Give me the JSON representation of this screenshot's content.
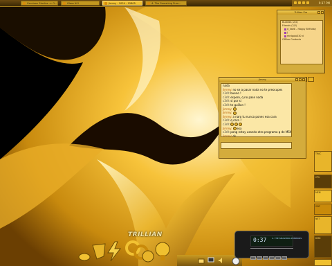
{
  "taskbar": {
    "tasks": [
      {
        "label": "Cerulean Studios -> O...",
        "active": false
      },
      {
        "label": "Glass N-2",
        "active": false
      },
      {
        "label": "Jimmy - 1024 - 15805",
        "active": true
      },
      {
        "label": "4. The Smashing Pum...",
        "active": false
      }
    ],
    "clock": "9:37 PM"
  },
  "contacts": {
    "title": "Trillian Pro",
    "rows": [
      {
        "text": "Buddies (2/2)",
        "sub": false,
        "icon": false
      },
      {
        "text": "Friends (2/2)",
        "sub": false,
        "icon": false
      },
      {
        "text": "d_kaeb - Happy Birthday",
        "sub": true,
        "icon": true
      },
      {
        "text": "j",
        "sub": true,
        "icon": true
      },
      {
        "text": "mrdpolo330 d",
        "sub": true,
        "icon": true
      },
      {
        "text": "Offline Contacts",
        "sub": false,
        "icon": false
      }
    ]
  },
  "chat": {
    "title": "Jimmy",
    "messages": [
      {
        "nick": "",
        "text": "nada",
        "emo": 0
      },
      {
        "nick": "Jimmy:",
        "text": "no se a pasar nada no te preocupes",
        "emo": 0
      },
      {
        "nick": "c3r0:",
        "text": "bueno !",
        "emo": 0
      },
      {
        "nick": "c3r0:",
        "text": "espero, q no pase nada",
        "emo": 0
      },
      {
        "nick": "c3r0:",
        "text": "si por si",
        "emo": 0
      },
      {
        "nick": "c3r0:",
        "text": "te guillan !",
        "emo": 0
      },
      {
        "nick": "Jimmy:",
        "text": "",
        "emo": 1
      },
      {
        "nick": "Jimmy:",
        "text": "",
        "emo": 1
      },
      {
        "nick": "Jimmy:",
        "text": "a naro tu nunca pones esa cara",
        "emo": 0
      },
      {
        "nick": "c3r0:",
        "text": "q cara ?",
        "emo": 0
      },
      {
        "nick": "c3r0:",
        "text": "",
        "emo": 3
      },
      {
        "nick": "Jimmy:",
        "text": "esa",
        "emo": 1
      },
      {
        "nick": "c3r0:",
        "text": "pong estoy usando otro programa q de MSN",
        "emo": 0
      },
      {
        "nick": "Jimmy:",
        "text": "ok",
        "emo": 0
      }
    ]
  },
  "dock": {
    "logo": "TRILLIAN"
  },
  "player": {
    "time": "0:37",
    "track": "4. THE SMASHING PUMPKINS"
  },
  "right_dock": {
    "labels": [
      "TRAC",
      "CPU",
      "MEM",
      "SWP",
      "NET",
      "DISK"
    ]
  },
  "colors": {
    "accent": "#f0c02f",
    "dark": "#3a2705"
  }
}
